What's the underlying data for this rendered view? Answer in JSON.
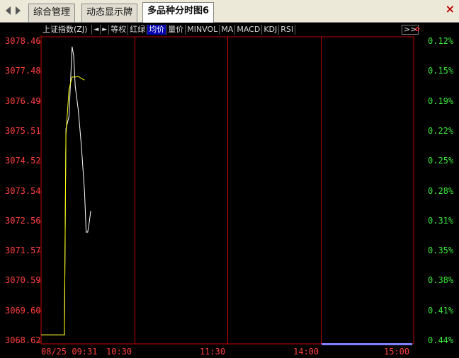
{
  "tabs": [
    {
      "label": "综合管理",
      "active": false
    },
    {
      "label": "动态显示牌",
      "active": false
    },
    {
      "label": "多品种分时图6",
      "active": true
    }
  ],
  "toolbar": {
    "title": "上证指数(ZJ)",
    "prev_icon": "◄",
    "next_icon": "►",
    "buttons": [
      "等权",
      "红绿",
      "均价",
      "量价",
      "MINVOL",
      "MA",
      "MACD",
      "KDJ",
      "RSI"
    ],
    "active_button": "均价",
    "more": ">>",
    "mark": "✿"
  },
  "y_axis": {
    "price_labels": [
      "3078.46",
      "3077.48",
      "3076.49",
      "3075.51",
      "3074.52",
      "3073.54",
      "3072.56",
      "3071.57",
      "3070.59",
      "3069.60",
      "3068.62"
    ],
    "percent_labels": [
      "0.12%",
      "0.15%",
      "0.19%",
      "0.22%",
      "0.25%",
      "0.28%",
      "0.31%",
      "0.35%",
      "0.38%",
      "0.41%",
      "0.44%"
    ]
  },
  "x_axis": {
    "labels": [
      "08/25 09:31",
      "10:30",
      "11:30",
      "14:00",
      "15:00"
    ]
  },
  "chart_data": {
    "type": "line",
    "title": "上证指数(ZJ)",
    "ylim": [
      3068.62,
      3078.46
    ],
    "xlim": [
      0,
      240
    ],
    "x_unit": "trading minutes from 09:30",
    "series": [
      {
        "color": "#ffffff",
        "x": [
          0,
          2,
          5,
          8,
          11,
          14,
          15,
          16,
          18,
          20,
          21,
          22,
          24,
          26,
          28,
          29,
          30,
          31,
          32
        ],
        "y": [
          3068.82,
          3068.82,
          3068.82,
          3068.82,
          3068.82,
          3068.82,
          3068.82,
          3075.6,
          3076.0,
          3078.3,
          3078.0,
          3077.0,
          3076.2,
          3075.0,
          3073.5,
          3072.2,
          3072.2,
          3072.5,
          3072.9
        ]
      },
      {
        "color": "#ffff00",
        "x": [
          0,
          14,
          15,
          16,
          18,
          20,
          22,
          24,
          26,
          28
        ],
        "y": [
          3068.82,
          3068.82,
          3068.82,
          3075.4,
          3076.9,
          3077.3,
          3077.3,
          3077.32,
          3077.25,
          3077.2
        ]
      }
    ],
    "colors": {
      "grid": "#c00000",
      "price_axis": "#ff4040",
      "percent_axis": "#3ce63c",
      "price_line": "#ffffff",
      "avg_line": "#ffff00"
    }
  }
}
